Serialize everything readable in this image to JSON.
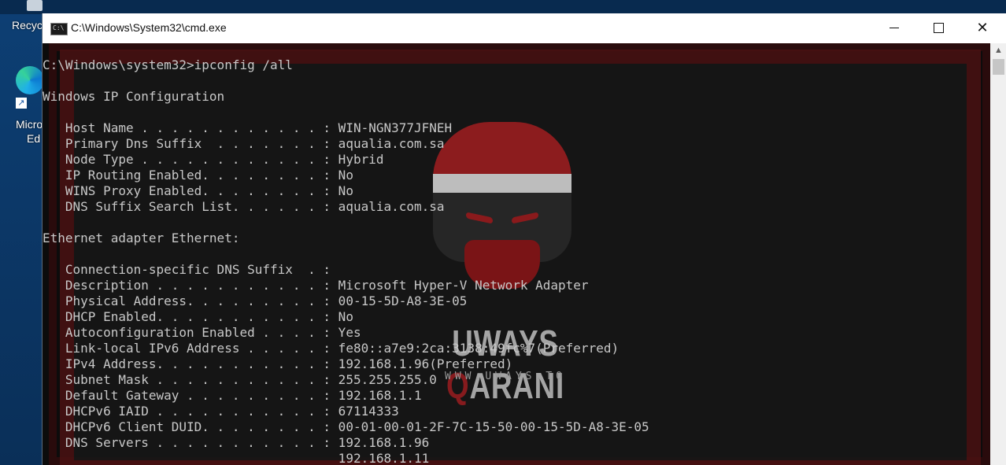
{
  "desktop": {
    "recycle_label": "Recyc",
    "edge_label1": "Micro",
    "edge_label2": "Ed"
  },
  "window": {
    "title": "C:\\Windows\\System32\\cmd.exe",
    "icon_text": "C:\\"
  },
  "console": {
    "lines": [
      "C:\\Windows\\system32>ipconfig /all",
      "",
      "Windows IP Configuration",
      "",
      "   Host Name . . . . . . . . . . . . : WIN-NGN377JFNEH",
      "   Primary Dns Suffix  . . . . . . . : aqualia.com.sa",
      "   Node Type . . . . . . . . . . . . : Hybrid",
      "   IP Routing Enabled. . . . . . . . : No",
      "   WINS Proxy Enabled. . . . . . . . : No",
      "   DNS Suffix Search List. . . . . . : aqualia.com.sa",
      "",
      "Ethernet adapter Ethernet:",
      "",
      "   Connection-specific DNS Suffix  . :",
      "   Description . . . . . . . . . . . : Microsoft Hyper-V Network Adapter",
      "   Physical Address. . . . . . . . . : 00-15-5D-A8-3E-05",
      "   DHCP Enabled. . . . . . . . . . . : No",
      "   Autoconfiguration Enabled . . . . : Yes",
      "   Link-local IPv6 Address . . . . . : fe80::a7e9:2ca:3138:49fc%7(Preferred)",
      "   IPv4 Address. . . . . . . . . . . : 192.168.1.96(Preferred)",
      "   Subnet Mask . . . . . . . . . . . : 255.255.255.0",
      "   Default Gateway . . . . . . . . . : 192.168.1.1",
      "   DHCPv6 IAID . . . . . . . . . . . : 67114333",
      "   DHCPv6 Client DUID. . . . . . . . : 00-01-00-01-2F-7C-15-50-00-15-5D-A8-3E-05",
      "   DNS Servers . . . . . . . . . . . : 192.168.1.96",
      "                                       192.168.1.11"
    ]
  },
  "watermark": {
    "title_a": "UWAYS ",
    "title_q": "Q",
    "title_b": "ARANI",
    "subtitle": "WWW.UWAYS.TO"
  },
  "colors": {
    "console_text": "#c8c8c8",
    "console_bg": "#0c0c0c",
    "accent_red": "#9a1d20"
  }
}
